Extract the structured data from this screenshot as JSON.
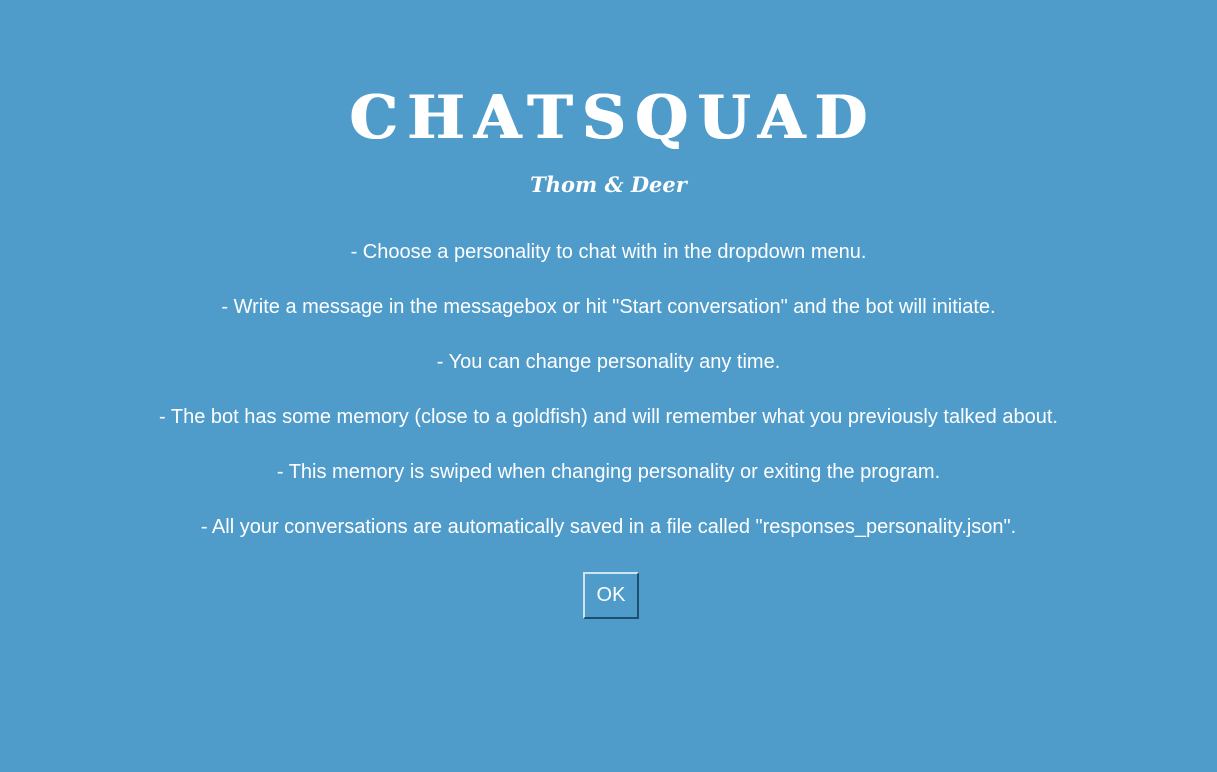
{
  "app": {
    "title": "CHATSQUAD",
    "subtitle": "Thom & Deer"
  },
  "instructions": [
    "- Choose a personality to chat with in the dropdown menu.",
    "- Write a message in the messagebox or hit \"Start conversation\" and the bot will initiate.",
    "- You can change personality any time.",
    "- The bot has some memory (close to a goldfish) and will remember what you previously talked about.",
    "- This memory is swiped when changing personality or exiting the program.",
    "- All your conversations are automatically saved in a file called \"responses_personality.json\"."
  ],
  "ok_button": {
    "label": "OK"
  },
  "colors": {
    "background": "#4f9ccb",
    "text": "#ffffff"
  }
}
